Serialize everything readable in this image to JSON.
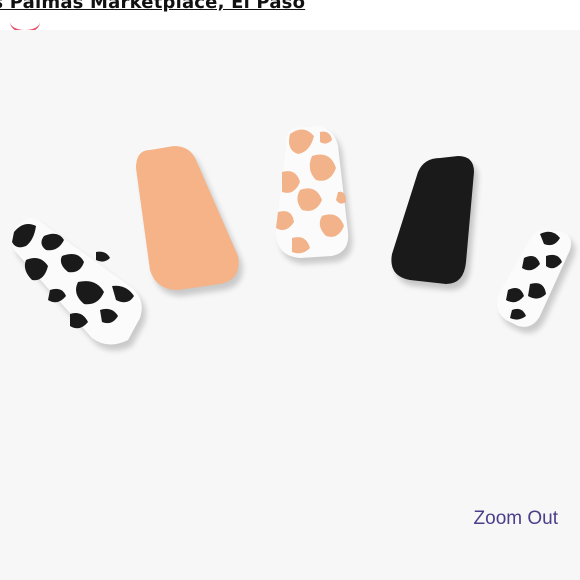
{
  "header": {
    "store_link": "ls Palmas Marketplace, El Paso"
  },
  "product_image": {
    "alt": "press-on nails",
    "nails": [
      {
        "design": "cow-print"
      },
      {
        "design": "solid-peach"
      },
      {
        "design": "peach-cow-print"
      },
      {
        "design": "solid-black"
      },
      {
        "design": "cow-print"
      }
    ]
  },
  "zoom": {
    "label": "Zoom Out"
  },
  "colors": {
    "background": "#f7f7f7",
    "peach": "#f5b387",
    "black": "#1b1a1a",
    "white_nail": "#fbfbfb",
    "zoom_text": "#4b3f8a",
    "accent_red": "#e0284a"
  }
}
